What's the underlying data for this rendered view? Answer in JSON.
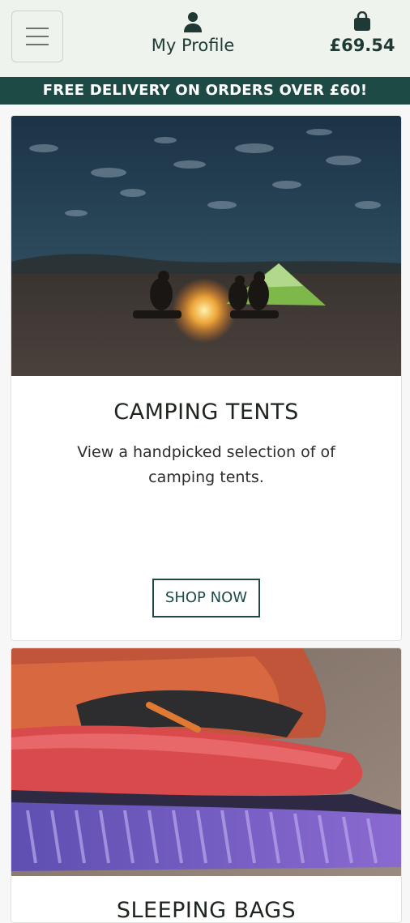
{
  "header": {
    "menu_icon": "hamburger-icon",
    "profile_icon": "user-icon",
    "profile_label": "My Profile",
    "basket_icon": "shopping-bag-icon",
    "basket_total": "£69.54"
  },
  "banner": {
    "text": "FREE DELIVERY ON ORDERS OVER £60!"
  },
  "cards": [
    {
      "title": "CAMPING TENTS",
      "description": "View a handpicked selection of of camping tents.",
      "button_label": "SHOP NOW"
    },
    {
      "title": "SLEEPING BAGS"
    }
  ],
  "colors": {
    "brand": "#1d4a44",
    "header_bg": "#eef3ee"
  }
}
